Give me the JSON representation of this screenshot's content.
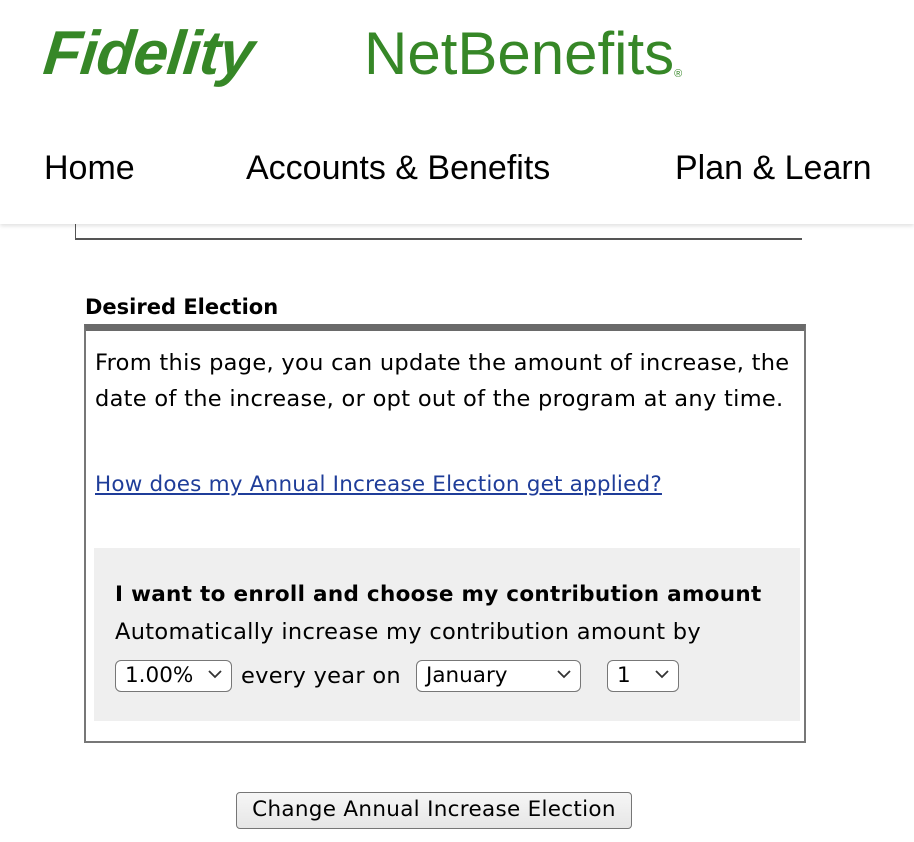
{
  "header": {
    "logo_brand": "Fidelity",
    "logo_product": "NetBenefits",
    "logo_mark": "®",
    "brand_color": "#368727"
  },
  "nav": {
    "items": [
      {
        "label": "Home"
      },
      {
        "label": "Accounts & Benefits"
      },
      {
        "label": "Plan & Learn"
      }
    ]
  },
  "election": {
    "section_title": "Desired Election",
    "intro_text": "From this page, you can update the amount of increase, the date of the increase, or opt out of the program at any time.",
    "help_link": "How does my Annual Increase Election get applied?",
    "enroll_heading": "I want to enroll and choose my contribution amount",
    "enroll_description": "Automatically increase my contribution amount by",
    "increase_amount": "1.00%",
    "every_year_text": "every year on",
    "month": "January",
    "day": "1",
    "link_color": "#1f3d99"
  },
  "actions": {
    "change_button": "Change Annual Increase Election"
  }
}
